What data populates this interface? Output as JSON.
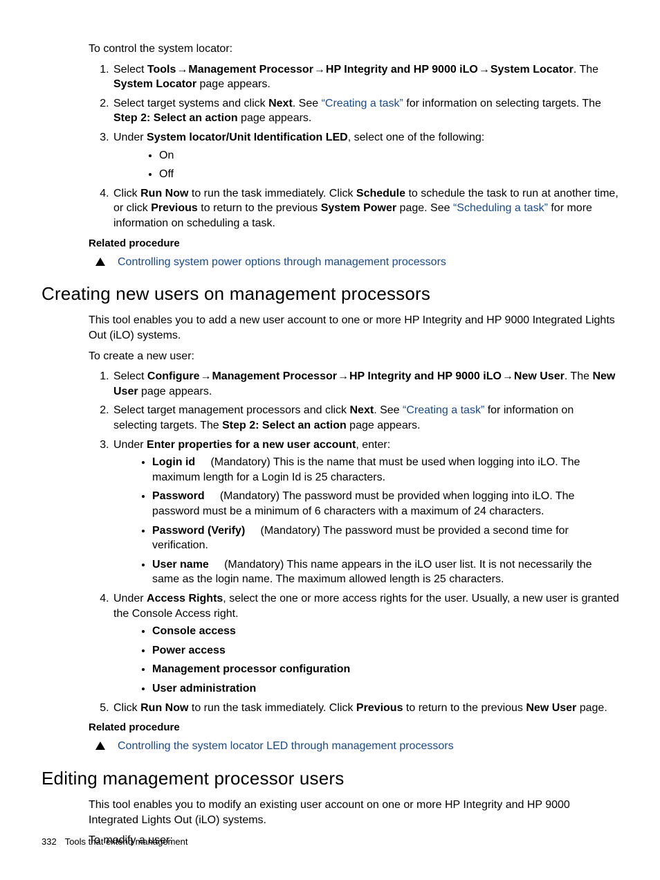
{
  "intro1": "To control the system locator:",
  "s1": {
    "li1_a": "Select ",
    "li1_b1": "Tools",
    "li1_b2": "Management Processor",
    "li1_b3": "HP Integrity and HP 9000 iLO",
    "li1_b4": "System Locator",
    "li1_c": ". The ",
    "li1_d": "System Locator",
    "li1_e": " page appears.",
    "li2_a": "Select target systems and click ",
    "li2_b": "Next",
    "li2_c": ". See ",
    "li2_link": "“Creating a task”",
    "li2_d": " for information on selecting targets. The ",
    "li2_e": "Step 2: Select an action",
    "li2_f": " page appears.",
    "li3_a": "Under ",
    "li3_b": "System locator/Unit Identification LED",
    "li3_c": ", select one of the following:",
    "on": "On",
    "off": "Off",
    "li4_a": "Click ",
    "li4_b": "Run Now",
    "li4_c": " to run the task immediately. Click ",
    "li4_d": "Schedule",
    "li4_e": " to schedule the task to run at another time, or click ",
    "li4_f": "Previous",
    "li4_g": " to return to the previous ",
    "li4_h": "System Power",
    "li4_i": " page. See ",
    "li4_link": "“Scheduling a task”",
    "li4_j": " for more information on scheduling a task."
  },
  "related_label": "Related procedure",
  "related1_link": "Controlling system power options through management processors",
  "h_section2": "Creating new users on management processors",
  "p_sec2_intro": "This tool enables you to add a new user account to one or more HP Integrity and HP 9000 Integrated Lights Out (iLO) systems.",
  "p_sec2_lead": "To create a new user:",
  "s2": {
    "li1_a": "Select ",
    "li1_b1": "Configure",
    "li1_b2": "Management Processor",
    "li1_b3": "HP Integrity and HP 9000 iLO",
    "li1_b4": "New User",
    "li1_c": ". The ",
    "li1_d": "New User",
    "li1_e": " page appears.",
    "li2_a": "Select target management processors and click ",
    "li2_b": "Next",
    "li2_c": ". See ",
    "li2_link": "“Creating a task”",
    "li2_d": " for information on selecting targets. The ",
    "li2_e": "Step 2: Select an action",
    "li2_f": " page appears.",
    "li3_a": "Under ",
    "li3_b": "Enter properties for a new user account",
    "li3_c": ", enter:",
    "prop_login_label": "Login id",
    "prop_login_text": "(Mandatory) This is the name that must be used when logging into iLO. The maximum length for a Login Id is 25 characters.",
    "prop_pw_label": "Password",
    "prop_pw_text": "(Mandatory) The password must be provided when logging into iLO. The password must be a minimum of 6 characters with a maximum of 24 characters.",
    "prop_pwv_label": "Password (Verify)",
    "prop_pwv_text": "(Mandatory) The password must be provided a second time for verification.",
    "prop_un_label": "User name",
    "prop_un_text": "(Mandatory) This name appears in the iLO user list. It is not necessarily the same as the login name. The maximum allowed length is 25 characters.",
    "li4_a": "Under ",
    "li4_b": "Access Rights",
    "li4_c": ", select the one or more access rights for the user. Usually, a new user is granted the Console Access right.",
    "ar1": "Console access",
    "ar2": "Power access",
    "ar3": "Management processor configuration",
    "ar4": "User administration",
    "li5_a": "Click ",
    "li5_b": "Run Now",
    "li5_c": " to run the task immediately. Click ",
    "li5_d": "Previous",
    "li5_e": " to return to the previous ",
    "li5_f": "New User",
    "li5_g": " page."
  },
  "related2_link": "Controlling the system locator LED through management processors",
  "h_section3": "Editing management processor users",
  "p_sec3_intro": "This tool enables you to modify an existing user account on one or more HP Integrity and HP 9000 Integrated Lights Out (iLO) systems.",
  "p_sec3_lead": "To modify a user:",
  "footer_page": "332",
  "footer_title": "Tools that extend management",
  "arrow": "→"
}
